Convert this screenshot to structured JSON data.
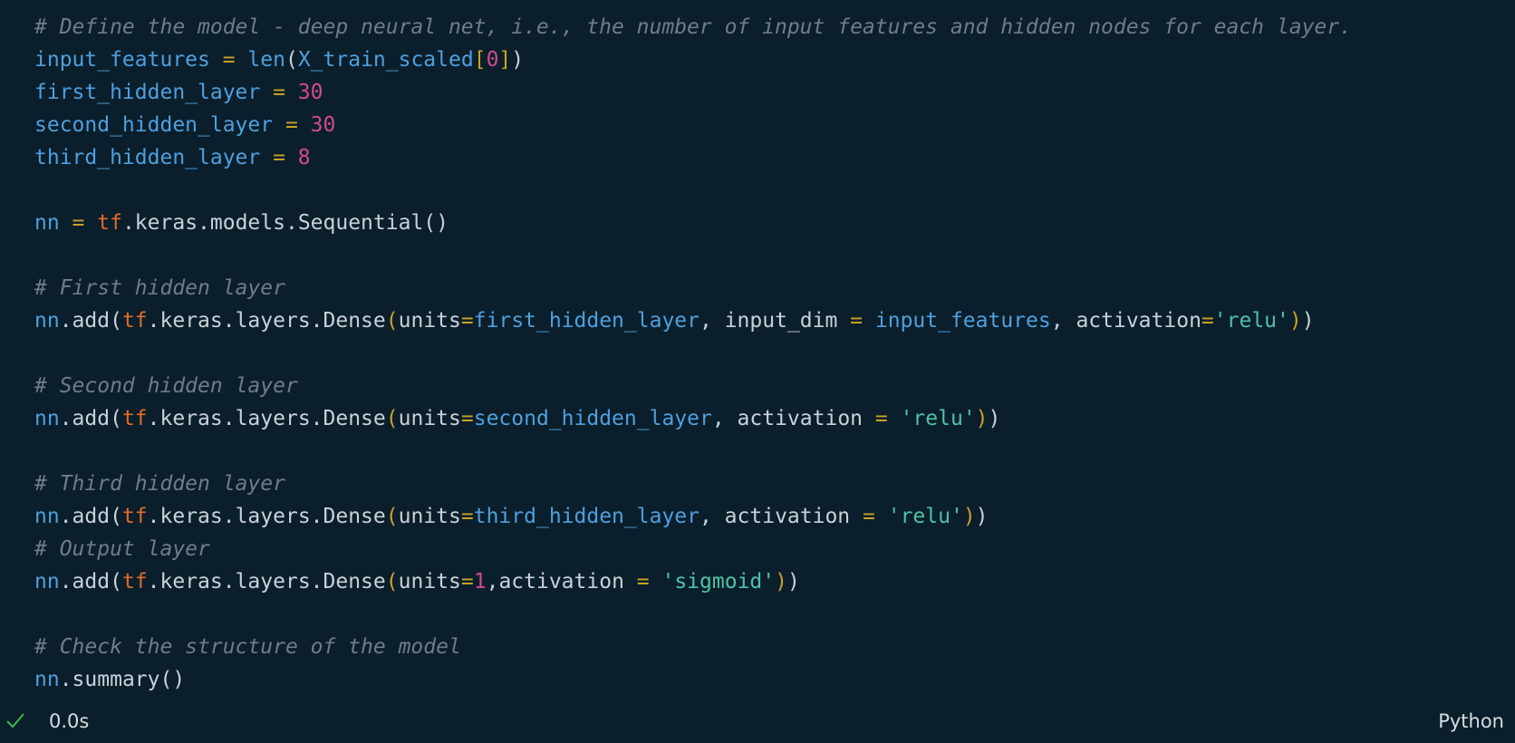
{
  "cell": {
    "lines": [
      [
        {
          "t": "# Define the model - deep neural net, i.e., the number of input features and hidden nodes for each layer.",
          "c": "comment"
        }
      ],
      [
        {
          "t": "input_features",
          "c": "var"
        },
        {
          "t": " = ",
          "c": "op"
        },
        {
          "t": "len",
          "c": "builtin"
        },
        {
          "t": "(",
          "c": "plain"
        },
        {
          "t": "X_train_scaled",
          "c": "var"
        },
        {
          "t": "[",
          "c": "paren"
        },
        {
          "t": "0",
          "c": "num"
        },
        {
          "t": "]",
          "c": "paren"
        },
        {
          "t": ")",
          "c": "plain"
        }
      ],
      [
        {
          "t": "first_hidden_layer",
          "c": "var"
        },
        {
          "t": " = ",
          "c": "op"
        },
        {
          "t": "30",
          "c": "num"
        }
      ],
      [
        {
          "t": "second_hidden_layer",
          "c": "var"
        },
        {
          "t": " = ",
          "c": "op"
        },
        {
          "t": "30",
          "c": "num"
        }
      ],
      [
        {
          "t": "third_hidden_layer",
          "c": "var"
        },
        {
          "t": " = ",
          "c": "op"
        },
        {
          "t": "8",
          "c": "num"
        }
      ],
      [],
      [
        {
          "t": "nn",
          "c": "var"
        },
        {
          "t": " = ",
          "c": "op"
        },
        {
          "t": "tf",
          "c": "module"
        },
        {
          "t": ".keras.models.Sequential()",
          "c": "plain"
        }
      ],
      [],
      [
        {
          "t": "# First hidden layer",
          "c": "comment"
        }
      ],
      [
        {
          "t": "nn",
          "c": "var"
        },
        {
          "t": ".add(",
          "c": "plain"
        },
        {
          "t": "tf",
          "c": "module"
        },
        {
          "t": ".keras.layers.Dense",
          "c": "plain"
        },
        {
          "t": "(",
          "c": "paren"
        },
        {
          "t": "units",
          "c": "plain"
        },
        {
          "t": "=",
          "c": "op"
        },
        {
          "t": "first_hidden_layer",
          "c": "var"
        },
        {
          "t": ", input_dim ",
          "c": "plain"
        },
        {
          "t": "=",
          "c": "op"
        },
        {
          "t": " ",
          "c": "plain"
        },
        {
          "t": "input_features",
          "c": "var"
        },
        {
          "t": ", activation",
          "c": "plain"
        },
        {
          "t": "=",
          "c": "op"
        },
        {
          "t": "'relu'",
          "c": "str"
        },
        {
          "t": ")",
          "c": "paren"
        },
        {
          "t": ")",
          "c": "plain"
        }
      ],
      [],
      [
        {
          "t": "# Second hidden layer",
          "c": "comment"
        }
      ],
      [
        {
          "t": "nn",
          "c": "var"
        },
        {
          "t": ".add(",
          "c": "plain"
        },
        {
          "t": "tf",
          "c": "module"
        },
        {
          "t": ".keras.layers.Dense",
          "c": "plain"
        },
        {
          "t": "(",
          "c": "paren"
        },
        {
          "t": "units",
          "c": "plain"
        },
        {
          "t": "=",
          "c": "op"
        },
        {
          "t": "second_hidden_layer",
          "c": "var"
        },
        {
          "t": ", activation ",
          "c": "plain"
        },
        {
          "t": "=",
          "c": "op"
        },
        {
          "t": " ",
          "c": "plain"
        },
        {
          "t": "'relu'",
          "c": "str"
        },
        {
          "t": ")",
          "c": "paren"
        },
        {
          "t": ")",
          "c": "plain"
        }
      ],
      [],
      [
        {
          "t": "# Third hidden layer",
          "c": "comment"
        }
      ],
      [
        {
          "t": "nn",
          "c": "var"
        },
        {
          "t": ".add(",
          "c": "plain"
        },
        {
          "t": "tf",
          "c": "module"
        },
        {
          "t": ".keras.layers.Dense",
          "c": "plain"
        },
        {
          "t": "(",
          "c": "paren"
        },
        {
          "t": "units",
          "c": "plain"
        },
        {
          "t": "=",
          "c": "op"
        },
        {
          "t": "third_hidden_layer",
          "c": "var"
        },
        {
          "t": ", activation ",
          "c": "plain"
        },
        {
          "t": "=",
          "c": "op"
        },
        {
          "t": " ",
          "c": "plain"
        },
        {
          "t": "'relu'",
          "c": "str"
        },
        {
          "t": ")",
          "c": "paren"
        },
        {
          "t": ")",
          "c": "plain"
        }
      ],
      [
        {
          "t": "# Output layer",
          "c": "comment"
        }
      ],
      [
        {
          "t": "nn",
          "c": "var"
        },
        {
          "t": ".add(",
          "c": "plain"
        },
        {
          "t": "tf",
          "c": "module"
        },
        {
          "t": ".keras.layers.Dense",
          "c": "plain"
        },
        {
          "t": "(",
          "c": "paren"
        },
        {
          "t": "units",
          "c": "plain"
        },
        {
          "t": "=",
          "c": "op"
        },
        {
          "t": "1",
          "c": "num"
        },
        {
          "t": ",activation ",
          "c": "plain"
        },
        {
          "t": "=",
          "c": "op"
        },
        {
          "t": " ",
          "c": "plain"
        },
        {
          "t": "'sigmoid'",
          "c": "str"
        },
        {
          "t": ")",
          "c": "paren"
        },
        {
          "t": ")",
          "c": "plain"
        }
      ],
      [],
      [
        {
          "t": "# Check the structure of the model",
          "c": "comment"
        }
      ],
      [
        {
          "t": "nn",
          "c": "var"
        },
        {
          "t": ".summary()",
          "c": "plain"
        }
      ]
    ]
  },
  "status": {
    "icon": "checkmark-icon",
    "exec_time": "0.0s",
    "language": "Python"
  },
  "colors": {
    "background": "#0a1f2b",
    "comment": "#6e7d87",
    "variable": "#4f9fde",
    "operator": "#c9a227",
    "number": "#d14a8a",
    "module": "#e06a2c",
    "string": "#4fc1a6",
    "success": "#3fb950"
  }
}
